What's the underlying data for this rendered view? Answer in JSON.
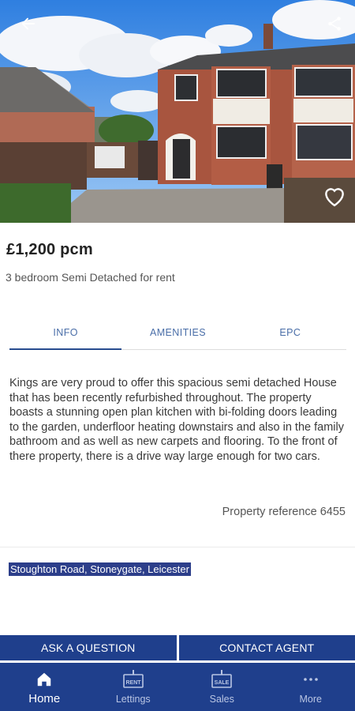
{
  "listing": {
    "price": "£1,200 pcm",
    "subtitle": "3 bedroom Semi Detached for rent",
    "description": "Kings are very proud to offer this spacious semi detached House that has been recently refurbished throughout. The property boasts a stunning open plan kitchen with bi-folding doors leading to the garden, underfloor heating downstairs and also in the family bathroom and as well as new carpets and flooring. To the front of there property, there is a drive way large enough for two cars.",
    "reference": "Property reference 6455",
    "address": "Stoughton Road, Stoneygate, Leicester"
  },
  "tabs": [
    {
      "label": "INFO",
      "active": true
    },
    {
      "label": "AMENITIES",
      "active": false
    },
    {
      "label": "EPC",
      "active": false
    }
  ],
  "actions": {
    "ask": "ASK A QUESTION",
    "contact": "CONTACT AGENT"
  },
  "nav": [
    {
      "label": "Home",
      "icon": "home-icon",
      "active": true
    },
    {
      "label": "Lettings",
      "icon": "lettings-sign-icon",
      "badge": "RENT",
      "active": false
    },
    {
      "label": "Sales",
      "icon": "sales-sign-icon",
      "badge": "SALE",
      "active": false
    },
    {
      "label": "More",
      "icon": "more-dots-icon",
      "active": false
    }
  ],
  "colors": {
    "brand": "#1f3f8c",
    "tab_text": "#4a6ea8",
    "address_highlight": "#2c3e8a"
  }
}
